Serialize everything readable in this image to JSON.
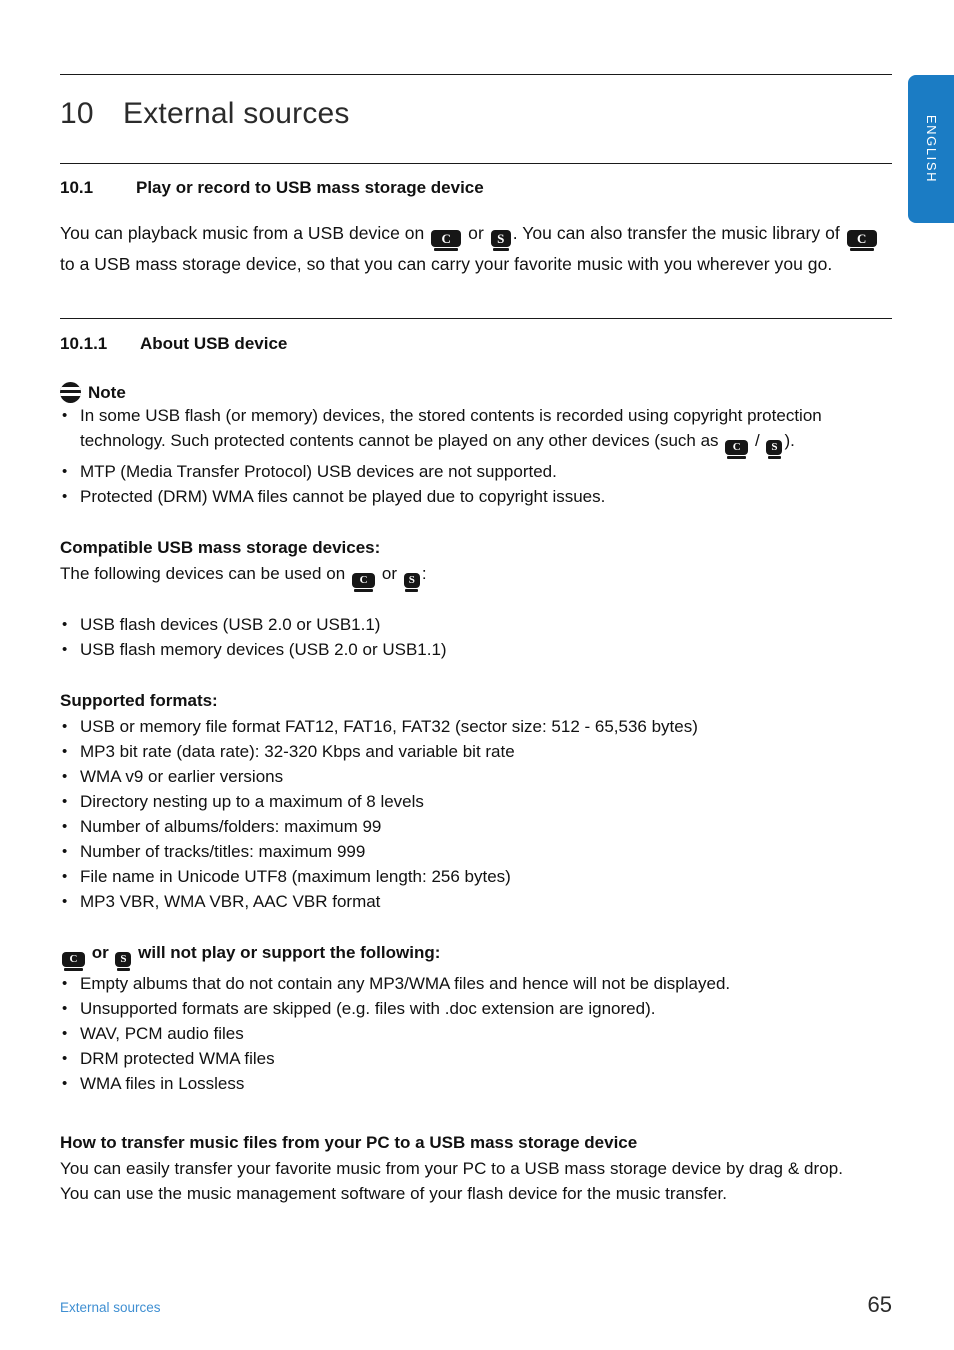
{
  "language_tab": {
    "label": "ENGLISH",
    "color": "#1b7cc4"
  },
  "chapter": {
    "number": "10",
    "title": "External sources"
  },
  "section": {
    "number": "10.1",
    "title": "Play or record to USB mass storage device"
  },
  "intro": {
    "part1": "You can playback music from a USB device on ",
    "part2": " or ",
    "part3": ". You can also transfer the music library of ",
    "part4": " to a USB mass storage device, so that you can carry your favorite music with you wherever you go."
  },
  "subsection": {
    "number": "10.1.1",
    "title": "About USB device"
  },
  "note": {
    "label": "Note",
    "icon": "note-circle-icon",
    "items": [
      {
        "text_before": "In some USB flash (or memory) devices, the stored contents is recorded using copyright protection technology. Such protected contents cannot be played on any other devices (such as ",
        "separator": " / ",
        "text_after": ")."
      },
      {
        "text": "MTP (Media Transfer Protocol) USB devices are not supported."
      },
      {
        "text": "Protected (DRM) WMA files cannot be played due to copyright issues."
      }
    ]
  },
  "compatible": {
    "title": "Compatible USB mass storage devices:",
    "lead_before": "The following devices can be used on ",
    "lead_middle": " or ",
    "lead_after": ":",
    "items": [
      "USB flash devices (USB 2.0 or USB1.1)",
      "USB flash memory devices (USB 2.0 or USB1.1)"
    ]
  },
  "supported": {
    "title": "Supported formats:",
    "items": [
      "USB or memory file format FAT12, FAT16, FAT32 (sector size: 512 - 65,536 bytes)",
      "MP3 bit rate (data rate): 32-320 Kbps and variable bit rate",
      "WMA v9 or earlier versions",
      "Directory nesting up to a maximum of 8 levels",
      "Number of albums/folders: maximum 99",
      "Number of tracks/titles: maximum 999",
      "File name in Unicode UTF8 (maximum length: 256 bytes)",
      "MP3 VBR, WMA VBR, AAC VBR format"
    ]
  },
  "unsupported": {
    "title_middle": " or ",
    "title_after": " will not play or support the following:",
    "items": [
      "Empty albums that do not contain any MP3/WMA files and hence will not be displayed.",
      "Unsupported formats are skipped (e.g. files with .doc extension are ignored).",
      "WAV, PCM audio files",
      "DRM protected WMA files",
      "WMA files in Lossless"
    ]
  },
  "transfer": {
    "title": "How to transfer music files from your PC to a USB mass storage device",
    "paragraph1": "You can easily transfer your favorite music from your PC to a USB mass storage device by drag & drop.",
    "paragraph2": "You can use the music management software of your flash device for the music transfer."
  },
  "devices": {
    "c_label": "C",
    "s_label": "S"
  },
  "footer": {
    "left": "External sources",
    "page": "65"
  }
}
